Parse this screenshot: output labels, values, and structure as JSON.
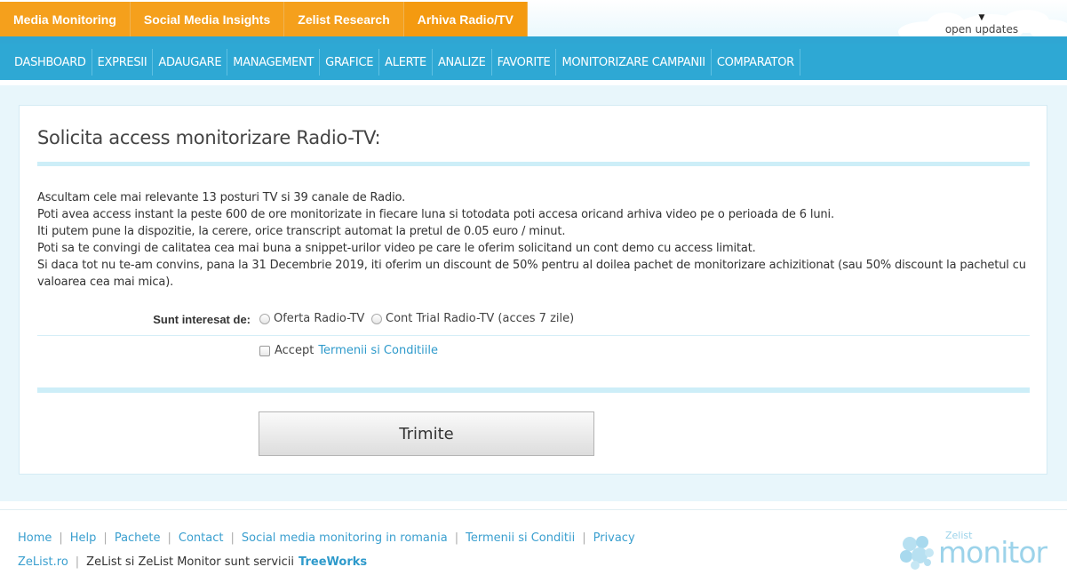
{
  "top_tabs": [
    {
      "label": "Media Monitoring"
    },
    {
      "label": "Social Media Insights"
    },
    {
      "label": "Zelist Research"
    },
    {
      "label": "Arhiva Radio/TV"
    }
  ],
  "updates": {
    "arrow": "▼",
    "label": "open updates"
  },
  "nav": [
    {
      "label": "DASHBOARD"
    },
    {
      "label": "EXPRESII"
    },
    {
      "label": "ADAUGARE"
    },
    {
      "label": "MANAGEMENT"
    },
    {
      "label": "GRAFICE"
    },
    {
      "label": "ALERTE"
    },
    {
      "label": "ANALIZE"
    },
    {
      "label": "FAVORITE"
    },
    {
      "label": "MONITORIZARE CAMPANII"
    },
    {
      "label": "COMPARATOR"
    }
  ],
  "card": {
    "title": "Solicita access monitorizare  Radio-TV:",
    "paragraphs": [
      "Ascultam cele mai relevante 13 posturi TV si 39 canale de  Radio.",
      "Poti avea access instant la peste 600 de ore monitorizate in fiecare luna si totodata poti accesa oricand arhiva video pe o perioada de 6 luni.",
      "Iti putem pune la dispozitie, la cerere, orice transcript automat la pretul de 0.05 euro / minut.",
      "Poti sa te convingi de calitatea cea mai buna a snippet-urilor video pe care le oferim solicitand un cont demo cu access limitat.",
      "Si daca tot nu te-am convins, pana la 31  Decembrie 2019, iti oferim un discount de 50% pentru al doilea pachet de monitorizare achizitionat (sau 50% discount la pachetul cu valoarea cea mai mica)."
    ],
    "form": {
      "interest_label": "Sunt interesat de:",
      "option1": "Oferta Radio-TV",
      "option2": "Cont Trial  Radio-TV (acces 7 zile)",
      "accept_prefix": "Accept",
      "terms_link": "Termenii si Conditiile"
    },
    "submit_label": "Trimite"
  },
  "footer": {
    "links": [
      {
        "label": "Home"
      },
      {
        "label": "Help"
      },
      {
        "label": "Pachete"
      },
      {
        "label": "Contact"
      },
      {
        "label": "Social media monitoring in romania"
      },
      {
        "label": "Termenii si Conditii"
      },
      {
        "label": "Privacy"
      }
    ],
    "site_link": "ZeList.ro",
    "services_text": "ZeList si ZeList  Monitor sunt servicii",
    "company_link": "TreeWorks",
    "logo_small": "Zelist",
    "logo_big": "monitor"
  },
  "colors": {
    "orange_tab": "#f5a01c",
    "nav_blue": "#2ea8d4",
    "link_blue": "#3a9fcf",
    "panel_bg": "#e8f6fb"
  }
}
